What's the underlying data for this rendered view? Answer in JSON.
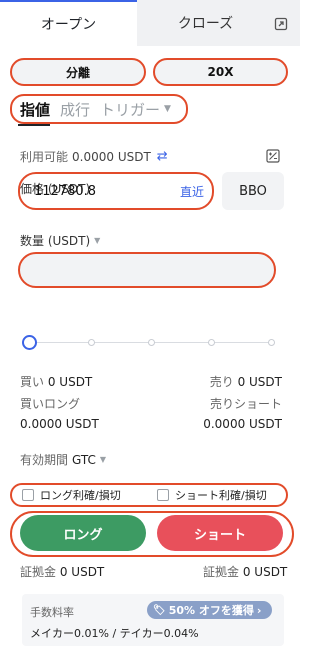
{
  "tabs": {
    "open": "オープン",
    "close": "クローズ"
  },
  "margin": {
    "mode": "分離",
    "leverage": "20X"
  },
  "order_types": {
    "limit": "指値",
    "market": "成行",
    "trigger": "トリガー"
  },
  "balance": {
    "label": "利用可能",
    "value": "0.0000 USDT"
  },
  "price": {
    "label": "価格 (USDT)",
    "value": "112780.8",
    "latest": "直近",
    "bbo": "BBO"
  },
  "quantity": {
    "label": "数量 (USDT)",
    "value": ""
  },
  "slider": {
    "level_percent": 0
  },
  "buy_sell": {
    "buy_label": "買い",
    "buy_value": "0 USDT",
    "sell_label": "売り",
    "sell_value": "0 USDT",
    "buy_long_label": "買いロング",
    "buy_long_value": "0.0000 USDT",
    "sell_short_label": "売りショート",
    "sell_short_value": "0.0000 USDT"
  },
  "validity": {
    "label": "有効期間",
    "value": "GTC"
  },
  "tp_sl": {
    "long": "ロング利確/損切",
    "short": "ショート利確/損切"
  },
  "buttons": {
    "long": "ロング",
    "short": "ショート"
  },
  "margin_info": {
    "left_label": "証拠金",
    "left_value": "0 USDT",
    "right_label": "証拠金",
    "right_value": "0 USDT"
  },
  "fees": {
    "label": "手数料率",
    "badge": "50% オフを獲得",
    "rates": "メイカー0.01% / テイカー0.04%"
  },
  "colors": {
    "accent": "#3b63e6",
    "long": "#3d9b63",
    "short": "#e8505b",
    "highlight": "#e24b2a"
  }
}
